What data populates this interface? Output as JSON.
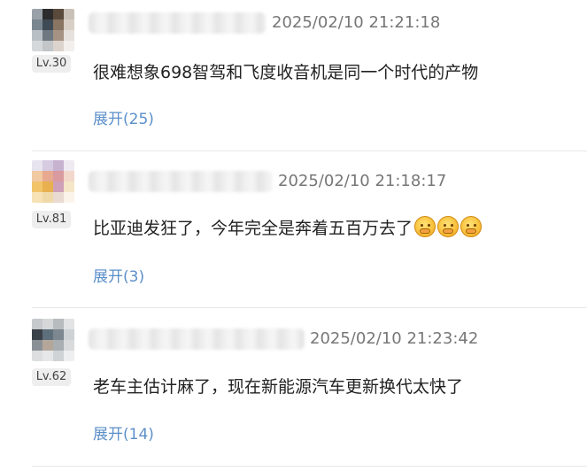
{
  "comments": [
    {
      "level": "Lv.30",
      "time": "2025/02/10 21:21:18",
      "text": "很难想象698智驾和飞度收音机是同一个时代的产物",
      "expand": "展开(25)",
      "avatar_colors": [
        "#9aa1a8",
        "#2c2c2c",
        "#5a4a3c",
        "#c9c1b8",
        "#7b8790",
        "#3e4b55",
        "#8a7462",
        "#d8cfc6",
        "#b9c0c5",
        "#6d7880",
        "#a59282",
        "#e6e1dc",
        "#d4d8db",
        "#c2c6c9",
        "#dcd3cc",
        "#f2efec"
      ]
    },
    {
      "level": "Lv.81",
      "time": "2025/02/10 21:18:17",
      "text": "比亚迪发狂了，今年完全是奔着五百万去了",
      "expand": "展开(3)",
      "emojis": [
        "laugh-cry-emoji",
        "laugh-cry-emoji",
        "laugh-cry-emoji"
      ],
      "avatar_colors": [
        "#e7e3ef",
        "#d6cbe1",
        "#c7b2cf",
        "#efeaf2",
        "#f1c9a3",
        "#e7a98f",
        "#d99aa0",
        "#f2d8cb",
        "#f2c46a",
        "#e8b04f",
        "#cfa1b8",
        "#f4e6c7",
        "#f7e2b5",
        "#f0d9a8",
        "#eadbd2",
        "#faf4ea"
      ]
    },
    {
      "level": "Lv.62",
      "time": "2025/02/10 21:23:42",
      "text": "老车主估计麻了，现在新能源汽车更新换代太快了",
      "expand": "展开(14)",
      "avatar_colors": [
        "#c6c9cc",
        "#d5d7d9",
        "#b7bbbe",
        "#e2e3e4",
        "#3b4148",
        "#5e6f7c",
        "#7d8790",
        "#cfd2d4",
        "#8b9096",
        "#b4a79a",
        "#a9aeb2",
        "#d9dbdc",
        "#dcdedf",
        "#e6e7e8",
        "#d0d3d5",
        "#eeeff0"
      ]
    }
  ]
}
